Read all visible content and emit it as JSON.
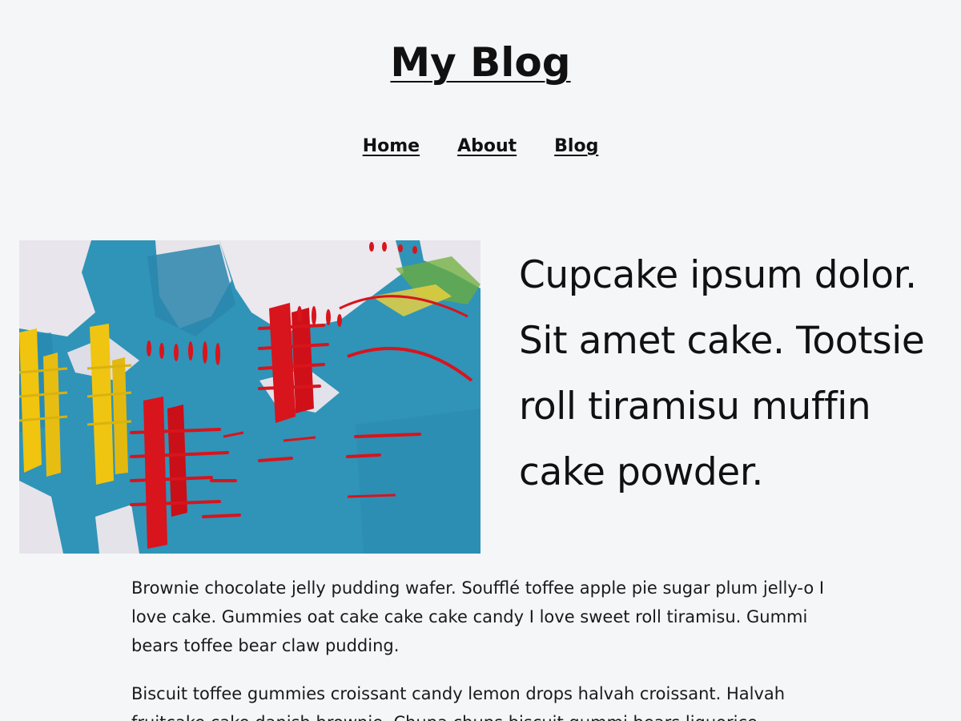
{
  "site": {
    "title": "My Blog"
  },
  "nav": {
    "items": [
      {
        "label": "Home"
      },
      {
        "label": "About"
      },
      {
        "label": "Blog"
      }
    ]
  },
  "hero": {
    "image_alt": "abstract blue, red and yellow painting",
    "text": "Cupcake ipsum dolor. Sit amet cake. Tootsie roll tiramisu muffin cake powder."
  },
  "article": {
    "paragraphs": [
      "Brownie chocolate jelly pudding wafer. Soufflé toffee apple pie sugar plum jelly-o I love cake. Gummies oat cake cake cake candy I love sweet roll tiramisu. Gummi bears toffee bear claw pudding.",
      "Biscuit toffee gummies croissant candy lemon drops halvah croissant. Halvah fruitcake cake danish brownie. Chupa chups biscuit gummi bears liquorice."
    ]
  },
  "colors": {
    "background": "#f5f6f8",
    "text": "#111111",
    "paint_blue": "#2f94b8",
    "paint_red": "#d8141c",
    "paint_yellow": "#f1c40f"
  }
}
